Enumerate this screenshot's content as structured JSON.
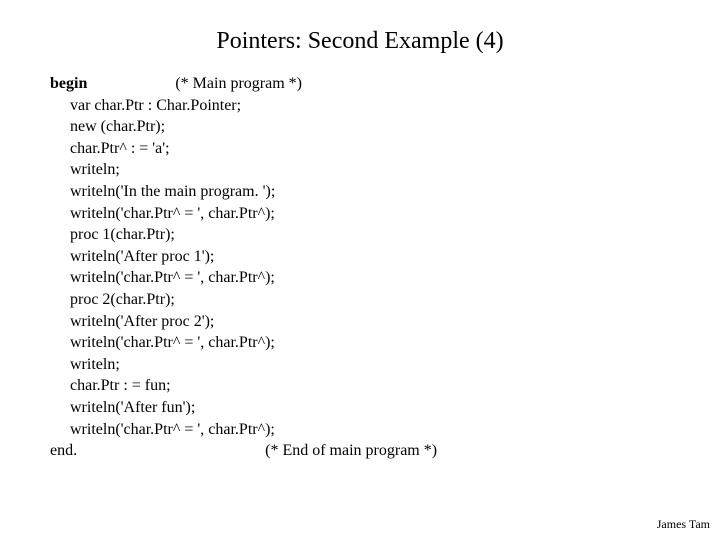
{
  "title": "Pointers: Second Example (4)",
  "code": {
    "begin_kw": "begin",
    "begin_comment": "(* Main program *)",
    "l1": "var char.Ptr : Char.Pointer;",
    "l2": "new (char.Ptr);",
    "l3": "char.Ptr^ : = 'a';",
    "l4": "writeln;",
    "l5": "writeln('In the main program. ');",
    "l6": "writeln('char.Ptr^ = ', char.Ptr^);",
    "l7": "proc 1(char.Ptr);",
    "l8": "writeln('After proc 1');",
    "l9": "writeln('char.Ptr^ = ', char.Ptr^);",
    "l10": "proc 2(char.Ptr);",
    "l11": "writeln('After proc 2');",
    "l12": "writeln('char.Ptr^ = ', char.Ptr^);",
    "l13": "writeln;",
    "l14": "char.Ptr : = fun;",
    "l15": "writeln('After fun');",
    "l16": "writeln('char.Ptr^ = ', char.Ptr^);",
    "end_kw": "end.",
    "end_comment": "(* End of main program *)"
  },
  "footer": "James Tam"
}
